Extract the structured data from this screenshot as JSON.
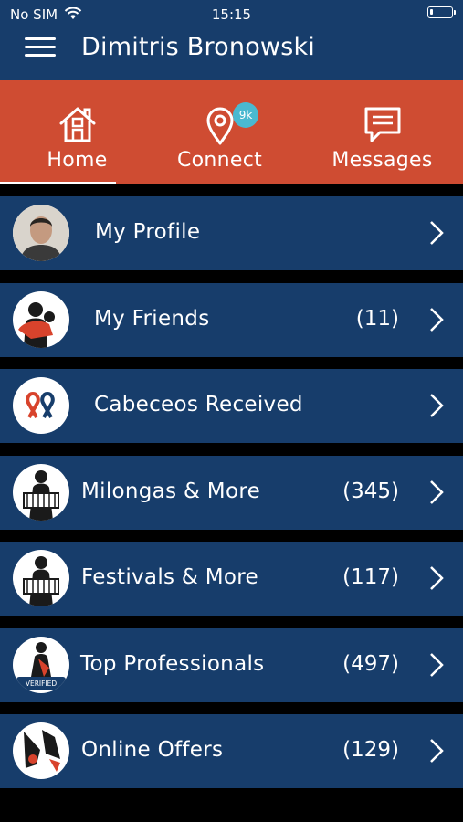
{
  "status_bar": {
    "carrier": "No SIM",
    "time": "15:15"
  },
  "header": {
    "title": "Dimitris Bronowski",
    "menu_icon": "hamburger-menu-icon"
  },
  "tabs": [
    {
      "label": "Home",
      "icon": "home-icon",
      "active": true
    },
    {
      "label": "Connect",
      "icon": "location-pin-icon",
      "badge": "9k"
    },
    {
      "label": "Messages",
      "icon": "chat-bubble-icon"
    }
  ],
  "menu": [
    {
      "label": "My Profile",
      "count": "",
      "icon": "profile-photo"
    },
    {
      "label": "My Friends",
      "count": "(11)",
      "icon": "friends-dancers-icon"
    },
    {
      "label": "Cabeceos Received",
      "count": "",
      "icon": "ribbons-icon"
    },
    {
      "label": "Milongas & More",
      "count": "(345)",
      "icon": "bandoneon-player-icon"
    },
    {
      "label": "Festivals & More",
      "count": "(117)",
      "icon": "bandoneon-player-icon"
    },
    {
      "label": "Top Professionals",
      "count": "(497)",
      "icon": "pro-verified-icon",
      "icon_text": "VERIFIED"
    },
    {
      "label": "Online Offers",
      "count": "(129)",
      "icon": "tango-shoes-icon"
    }
  ],
  "colors": {
    "header": "#173d6b",
    "tabs": "#cf4c32",
    "row": "#173d6b",
    "badge": "#4ab9d0",
    "background": "#000000"
  }
}
